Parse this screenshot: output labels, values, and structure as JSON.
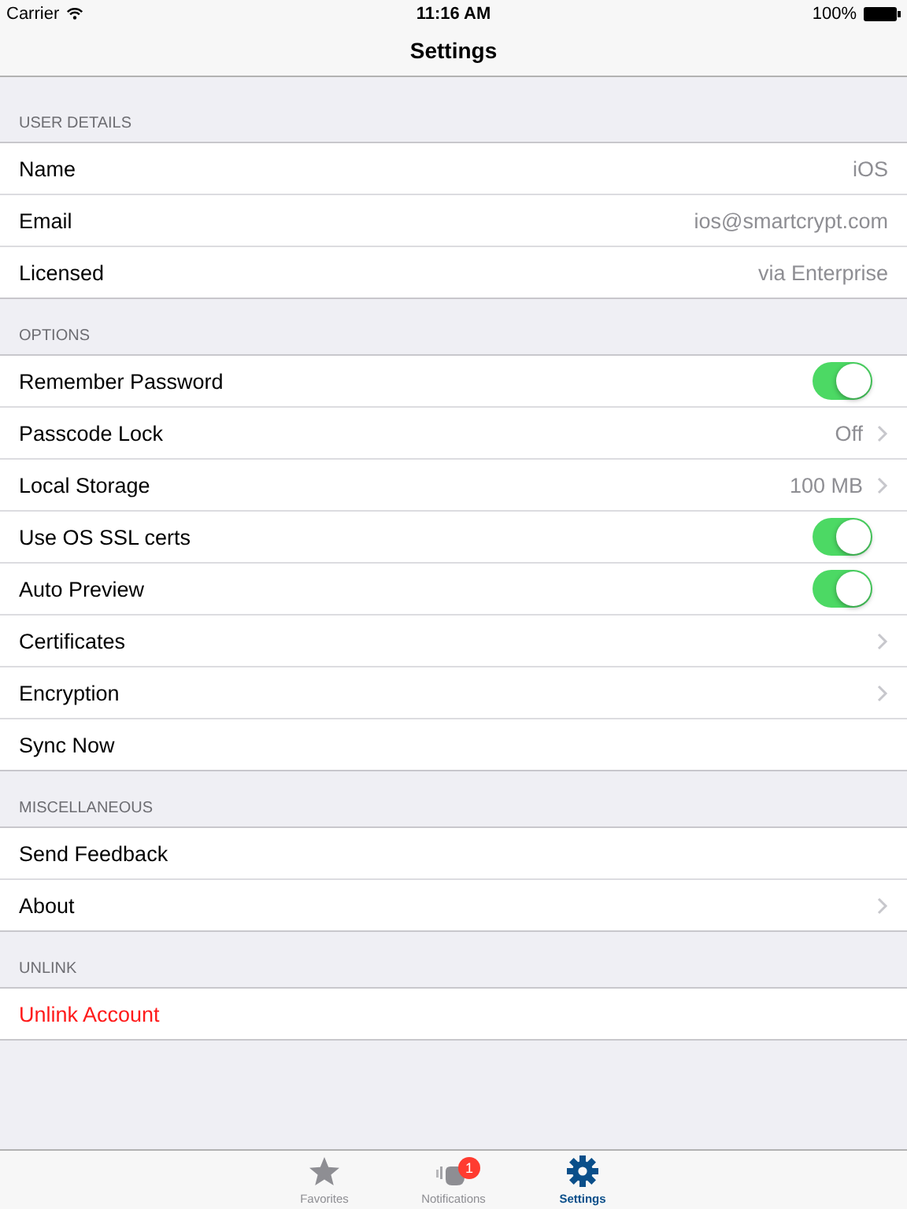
{
  "status_bar": {
    "carrier": "Carrier",
    "time": "11:16 AM",
    "battery": "100%"
  },
  "nav_bar": {
    "title": "Settings"
  },
  "sections": [
    {
      "header": "USER DETAILS",
      "rows": [
        {
          "kind": "value",
          "label": "Name",
          "value": "iOS"
        },
        {
          "kind": "value",
          "label": "Email",
          "value": "ios@smartcrypt.com"
        },
        {
          "kind": "value",
          "label": "Licensed",
          "value": "via Enterprise"
        }
      ]
    },
    {
      "header": "OPTIONS",
      "rows": [
        {
          "kind": "switch",
          "label": "Remember Password",
          "on": true
        },
        {
          "kind": "link",
          "label": "Passcode Lock",
          "value": "Off"
        },
        {
          "kind": "link",
          "label": "Local Storage",
          "value": "100 MB"
        },
        {
          "kind": "switch",
          "label": "Use OS SSL certs",
          "on": true
        },
        {
          "kind": "switch",
          "label": "Auto Preview",
          "on": true
        },
        {
          "kind": "link",
          "label": "Certificates"
        },
        {
          "kind": "link",
          "label": "Encryption"
        },
        {
          "kind": "action",
          "label": "Sync Now"
        }
      ]
    },
    {
      "header": "MISCELLANEOUS",
      "rows": [
        {
          "kind": "action",
          "label": "Send Feedback"
        },
        {
          "kind": "link",
          "label": "About"
        }
      ]
    },
    {
      "header": "UNLINK",
      "rows": [
        {
          "kind": "danger",
          "label": "Unlink Account"
        }
      ]
    }
  ],
  "tab_bar": [
    {
      "kind": "star",
      "label": "Favorites",
      "selected": false
    },
    {
      "kind": "hand",
      "label": "Notifications",
      "selected": false,
      "badge": "1"
    },
    {
      "kind": "gear",
      "label": "Settings",
      "selected": true
    }
  ]
}
